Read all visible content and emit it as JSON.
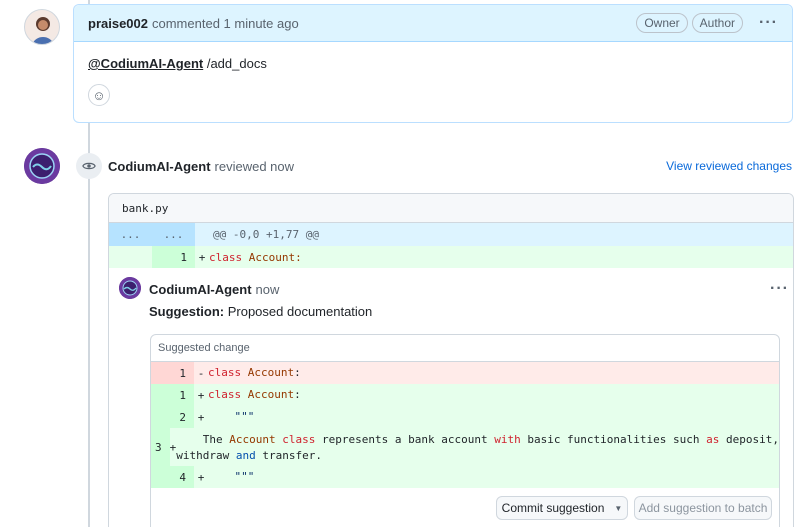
{
  "comment": {
    "author": "praise002",
    "meta": "commented 1 minute ago",
    "badges": [
      "Owner",
      "Author"
    ],
    "mention": "@CodiumAI-Agent",
    "body": "/add_docs",
    "menu": "···",
    "emoji": "☺"
  },
  "review": {
    "author": "CodiumAI-Agent",
    "meta": "reviewed now",
    "link": "View reviewed changes"
  },
  "file": {
    "name": "bank.py",
    "hunk_left": "...",
    "hunk_right": "...",
    "hunk": "@@ -0,0 +1,77 @@",
    "line_num": "1",
    "sign": "+",
    "code_kw": "class",
    "code_name": "Account:"
  },
  "inner": {
    "author": "CodiumAI-Agent",
    "meta": "now",
    "menu": "···",
    "suggestion_bold": "Suggestion:",
    "suggestion_text": " Proposed documentation",
    "suggested_change": "Suggested change"
  },
  "suggestion_lines": [
    {
      "type": "del",
      "num": "1",
      "sign": "-",
      "text": "class Account:"
    },
    {
      "type": "add",
      "num": "1",
      "sign": "+",
      "text": "class Account:"
    },
    {
      "type": "add",
      "num": "2",
      "sign": "+",
      "text": "    \"\"\""
    },
    {
      "type": "add",
      "num": "3",
      "sign": "+",
      "text": "    The Account class represents a bank account with basic functionalities such as deposit,",
      "text2": "withdraw and transfer."
    },
    {
      "type": "add",
      "num": "4",
      "sign": "+",
      "text": "    \"\"\""
    }
  ],
  "buttons": {
    "commit": "Commit suggestion",
    "batch": "Add suggestion to batch"
  }
}
